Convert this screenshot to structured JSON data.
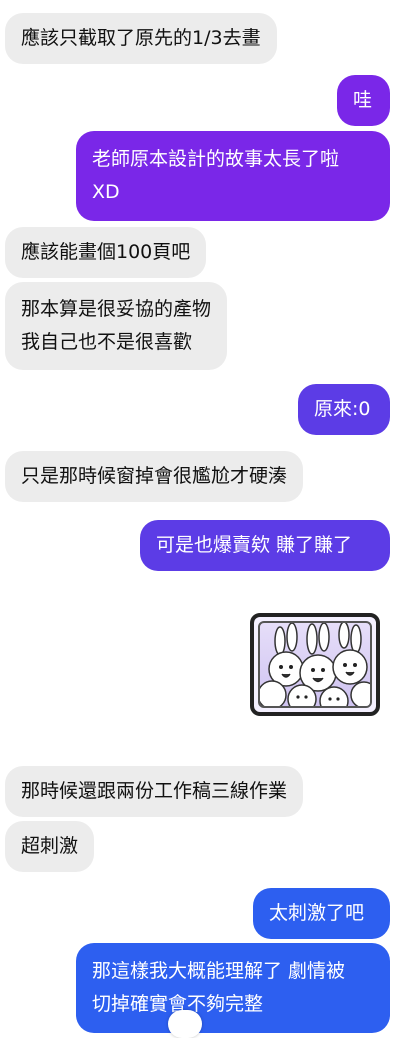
{
  "messages": [
    {
      "side": "received",
      "lines": [
        "應該只截取了原先的1/3去畫"
      ]
    },
    {
      "side": "sent",
      "lines": [
        "哇"
      ]
    },
    {
      "side": "sent",
      "lines": [
        "老師原本設計的故事太長了啦",
        "XD"
      ]
    },
    {
      "side": "received",
      "lines": [
        "應該能畫個100頁吧"
      ]
    },
    {
      "side": "received",
      "lines": [
        "那本算是很妥協的產物",
        "我自己也不是很喜歡"
      ]
    },
    {
      "side": "sent",
      "lines": [
        "原來:0"
      ]
    },
    {
      "side": "received",
      "lines": [
        "只是那時候窗掉會很尷尬才硬湊"
      ]
    },
    {
      "side": "sent",
      "lines": [
        "可是也爆賣欸 賺了賺了"
      ]
    },
    {
      "side": "received",
      "lines": [
        "那時候還跟兩份工作稿三線作業"
      ]
    },
    {
      "side": "received",
      "lines": [
        "超刺激"
      ]
    },
    {
      "side": "sent",
      "lines": [
        "太刺激了吧"
      ]
    },
    {
      "side": "sent",
      "lines": [
        "那這樣我大概能理解了 劇情被",
        "切掉確實會不夠完整"
      ]
    }
  ],
  "sticker": {
    "icon": "rabbit-group-sticker"
  },
  "colors": {
    "received_bubble": "#ececec",
    "sent_purple": "#7a27e8",
    "sent_violet": "#5c3ce6",
    "sent_blue": "#2d5ff0"
  }
}
